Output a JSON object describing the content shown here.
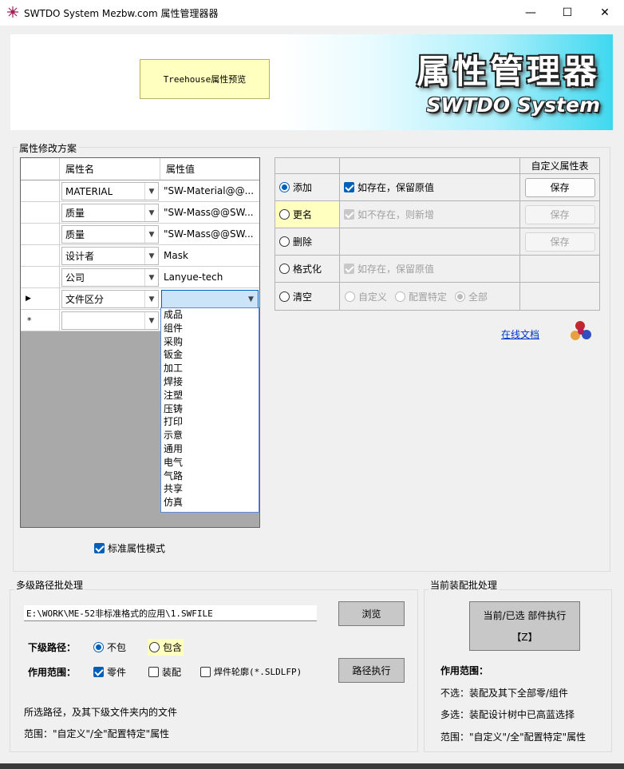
{
  "window": {
    "title": "SWTDO System Mezbw.com 属性管理器器",
    "minimize": "—",
    "maximize": "☐",
    "close": "✕"
  },
  "banner": {
    "preview_button": "Treehouse属性预览",
    "logo_cn": "属性管理器",
    "logo_en": "SWTDO System"
  },
  "scheme": {
    "group_label": "属性修改方案",
    "columns": [
      "属性名",
      "属性值"
    ],
    "rows": [
      {
        "name": "MATERIAL",
        "value": "\"SW-Material@@..."
      },
      {
        "name": "质量",
        "value": "\"SW-Mass@@SW..."
      },
      {
        "name": "质量",
        "value": "\"SW-Mass@@SW..."
      },
      {
        "name": "设计者",
        "value": "Mask"
      },
      {
        "name": "公司",
        "value": "Lanyue-tech"
      },
      {
        "name": "文件区分",
        "value": "",
        "indicator": "▶"
      },
      {
        "name": "",
        "value": "",
        "indicator": "*"
      }
    ],
    "dropdown_options": [
      "成品",
      "组件",
      "采购",
      "钣金",
      "加工",
      "焊接",
      "注塑",
      "压铸",
      "打印",
      "示意",
      "通用",
      "电气",
      "气路",
      "共享",
      "仿真"
    ],
    "standard_mode_label": "标准属性模式",
    "standard_mode_checked": true
  },
  "actions": {
    "custom_header": "自定义属性表",
    "rows": [
      {
        "label": "添加",
        "selected": true,
        "option": "如存在，保留原值",
        "option_checked": true,
        "option_enabled": true,
        "button": "保存",
        "button_enabled": true
      },
      {
        "label": "更名",
        "selected": false,
        "option": "如不存在，则新增",
        "option_checked": true,
        "option_enabled": false,
        "button": "保存",
        "button_enabled": false
      },
      {
        "label": "删除",
        "selected": false,
        "option": "",
        "button": "保存",
        "button_enabled": false
      },
      {
        "label": "格式化",
        "selected": false,
        "option": "如存在，保留原值",
        "option_checked": true,
        "option_enabled": false
      },
      {
        "label": "清空",
        "selected": false,
        "scopes": [
          "自定义",
          "配置特定",
          "全部"
        ],
        "scope_selected": "全部"
      }
    ],
    "online_doc": "在线文档"
  },
  "batch": {
    "group_label": "多级路径批处理",
    "path_value": "E:\\WORK\\ME-52非标准格式的应用\\1.SWFILE",
    "browse_button": "浏览",
    "subpath_label": "下级路径：",
    "subpath_options": [
      "不包",
      "包含"
    ],
    "subpath_selected": "不包",
    "scope_label": "作用范围：",
    "scope_options": [
      {
        "label": "零件",
        "checked": true
      },
      {
        "label": "装配",
        "checked": false
      },
      {
        "label": "焊件轮廓(*.SLDLFP)",
        "checked": false
      }
    ],
    "execute_button": "路径执行",
    "note1": "所选路径，及其下级文件夹内的文件",
    "note2": "范围：\"自定义\"/全\"配置特定\"属性"
  },
  "assembly": {
    "group_label": "当前装配批处理",
    "execute_button_line1": "当前/已选 部件执行",
    "execute_button_line2": "【Z】",
    "scope_label": "作用范围：",
    "note1": "不选：装配及其下全部零/组件",
    "note2": "多选：装配设计树中已高蓝选择",
    "note3": "范围：\"自定义\"/全\"配置特定\"属性"
  },
  "colors": {
    "accent": "#005fb8",
    "highlight": "#ffffc0",
    "grid_bg": "#a9a9a9",
    "banner_cyan": "#3fd8ef"
  }
}
